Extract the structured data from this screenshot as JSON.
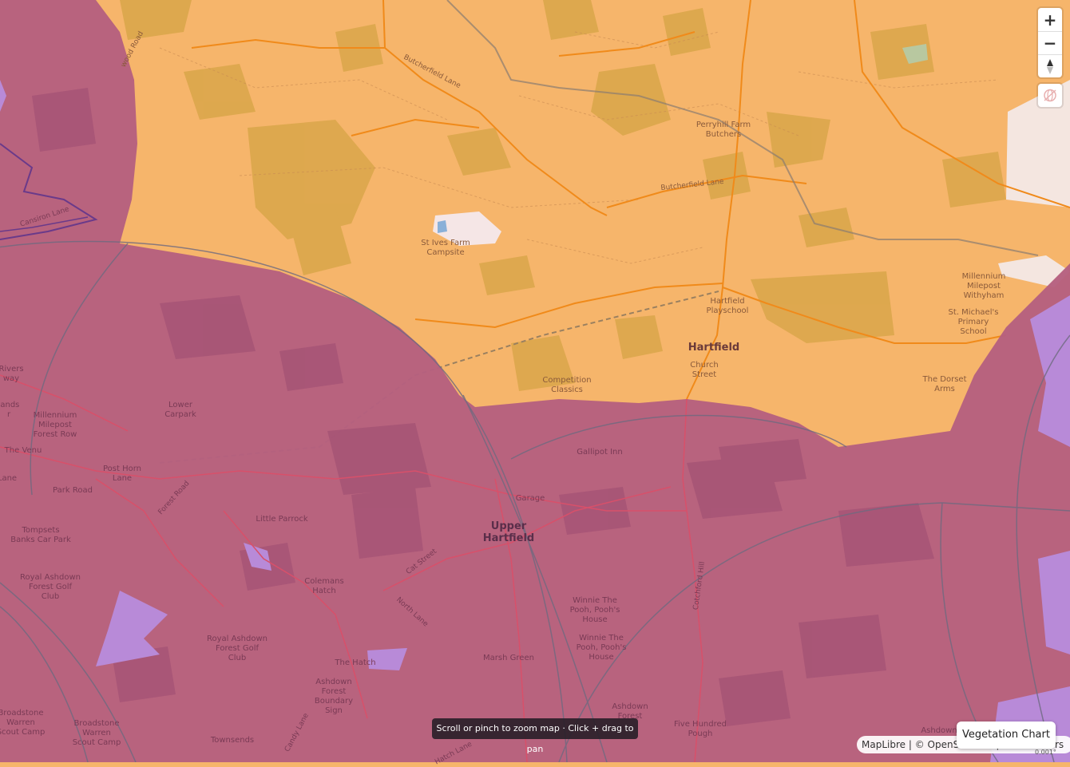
{
  "controls": {
    "zoom_in": "+",
    "zoom_out": "−",
    "compass_icon": "compass-icon",
    "globe_icon": "globe-off-icon"
  },
  "hint": "Scroll or pinch to zoom map · Click + drag to pan",
  "attribution": {
    "maplibre": "MapLibre",
    "separator": " | © ",
    "osm": "OpenStreetMap contributors"
  },
  "vegetation_button": "Vegetation Chart",
  "scale_text": "0.001°",
  "colors": {
    "orange_zone": "#f6b56b",
    "purple_zone": "#b5607f",
    "lavender_zone": "#b88ad8"
  },
  "labels": {
    "campsite": "St Ives Farm\nCampsite",
    "butchers": "Perryhill Farm\nButchers",
    "playschool": "Hartfield\nPlayschool",
    "hartfield": "Hartfield",
    "church_street": "Church\nStreet",
    "competition": "Competition\nClassics",
    "millennium_withyham": "Millennium\nMilepost\nWithyham",
    "st_michaels": "St. Michael's\nPrimary\nSchool",
    "dorset_arms": "The Dorset\nArms",
    "lower_carpark": "Lower\nCarpark",
    "millennium_forest_row": "Millennium\nMilepost\nForest Row",
    "post_horn": "Post Horn\nLane",
    "park_road": "Park Road",
    "the_venue": "The Venu",
    "tompsets": "Tompsets\nBanks Car Park",
    "little_parrock": "Little Parrock",
    "upper_hartfield": "Upper\nHartfield",
    "gallipot": "Gallipot Inn",
    "garage": "Garage",
    "colemans": "Colemans\nHatch",
    "royal_ashdown1": "Royal Ashdown\nForest Golf\nClub",
    "royal_ashdown2": "Royal Ashdown\nForest Golf\nClub",
    "the_hatch": "The Hatch",
    "ashdown_boundary": "Ashdown\nForest\nBoundary\nSign",
    "pooh1": "Winnie The\nPooh, Pooh's\nHouse",
    "pooh2": "Winnie The\nPooh, Pooh's\nHouse",
    "marsh_green": "Marsh Green",
    "broadstone1": "Broadstone\nWarren\nScout Camp",
    "broadstone2": "Broadstone\nWarren\nScout Camp",
    "townsends": "Townsends",
    "five_hundred": "Five Hundred\nPough",
    "ashdown_forest": "Ashdown\nForest",
    "butcherfield_lane": "Butcherfield Lane",
    "butcherfield_lane2": "Butcherfield Lane",
    "forest_road": "Forest Road",
    "cat_street": "Cat Street",
    "north_lane": "North Lane",
    "catsfield_hill": "Cotchford Hill",
    "candy_lane": "Candy Lane",
    "hatch_lane": "Hatch Lane",
    "wood_road": "wood Road",
    "cansiron_lane": "Cansiron Lane",
    "ashdown_right": "Ashdown",
    "rivers_way": "Rivers\nway",
    "lands": "lands\nr",
    "lane_left": "Lane"
  }
}
